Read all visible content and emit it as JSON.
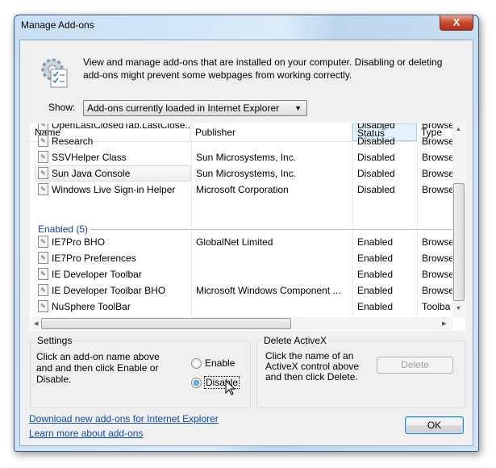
{
  "window": {
    "title": "Manage Add-ons",
    "close": "X"
  },
  "intro": "View and manage add-ons that are installed on your computer. Disabling or deleting add-ons might prevent some webpages from working correctly.",
  "show": {
    "label": "Show:",
    "value": "Add-ons currently loaded in Internet Explorer"
  },
  "columns": [
    "Name",
    "Publisher",
    "Status",
    "Type"
  ],
  "disabled_rows": [
    {
      "name": "OpenLastClosedTab.LastClose...",
      "publisher": "",
      "status": "Disabled",
      "type": "Browse"
    },
    {
      "name": "Research",
      "publisher": "",
      "status": "Disabled",
      "type": "Browse"
    },
    {
      "name": "SSVHelper Class",
      "publisher": "Sun Microsystems, Inc.",
      "status": "Disabled",
      "type": "Browse"
    },
    {
      "name": "Sun Java Console",
      "publisher": "Sun Microsystems, Inc.",
      "status": "Disabled",
      "type": "Browse"
    },
    {
      "name": "Windows Live Sign-in Helper",
      "publisher": "Microsoft Corporation",
      "status": "Disabled",
      "type": "Browse"
    }
  ],
  "enabled_group": "Enabled (5)",
  "enabled_rows": [
    {
      "name": "IE7Pro BHO",
      "publisher": "GlobalNet Limited",
      "status": "Enabled",
      "type": "Browse"
    },
    {
      "name": "IE7Pro Preferences",
      "publisher": "",
      "status": "Enabled",
      "type": "Browse"
    },
    {
      "name": "IE Developer Toolbar",
      "publisher": "",
      "status": "Enabled",
      "type": "Browse"
    },
    {
      "name": "IE Developer Toolbar BHO",
      "publisher": "Microsoft Windows Component ...",
      "status": "Enabled",
      "type": "Browse"
    },
    {
      "name": "NuSphere ToolBar",
      "publisher": "",
      "status": "Enabled",
      "type": "Toolba"
    }
  ],
  "settings": {
    "title": "Settings",
    "text": "Click an add-on name above and and then click Enable or Disable.",
    "enable": "Enable",
    "disable": "Disable",
    "selected": "Disable"
  },
  "delete": {
    "title": "Delete ActiveX",
    "text": "Click the name of an ActiveX control above and then click Delete.",
    "button": "Delete"
  },
  "links": {
    "download": "Download new add-ons for Internet Explorer",
    "learn": "Learn more about add-ons"
  },
  "ok": "OK"
}
